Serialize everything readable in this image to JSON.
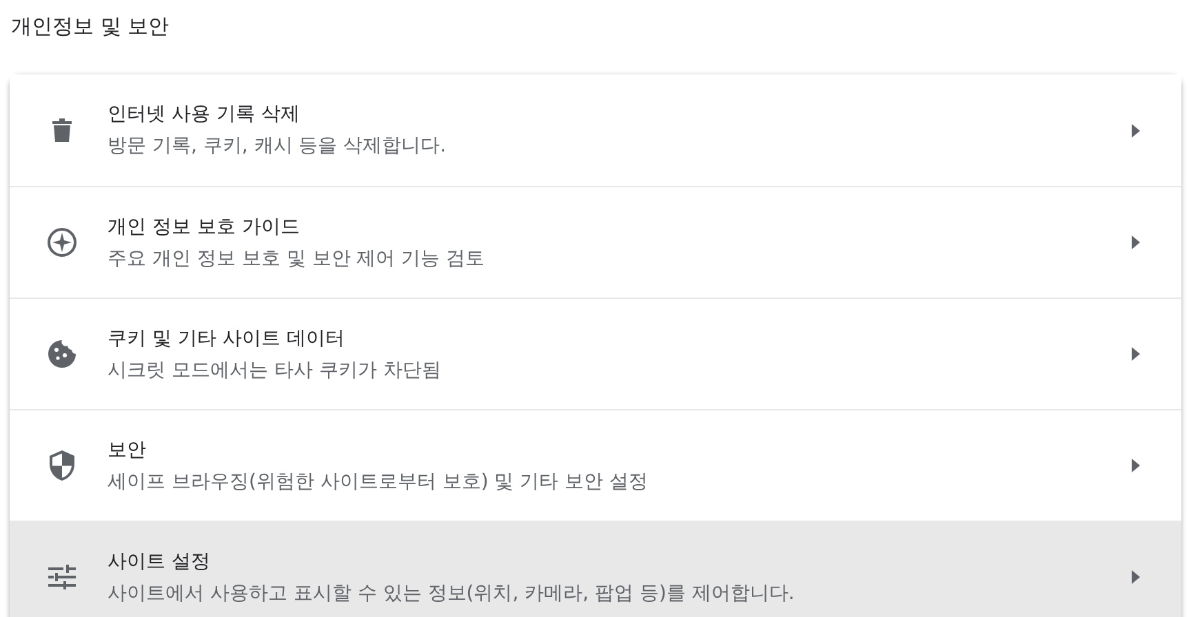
{
  "section_title": "개인정보 및 보안",
  "items": [
    {
      "kind": "delete",
      "title": "인터넷 사용 기록 삭제",
      "subtitle": "방문 기록, 쿠키, 캐시 등을 삭제합니다.",
      "highlighted": false
    },
    {
      "kind": "guide",
      "title": "개인 정보 보호 가이드",
      "subtitle": "주요 개인 정보 보호 및 보안 제어 기능 검토",
      "highlighted": false
    },
    {
      "kind": "cookies",
      "title": "쿠키 및 기타 사이트 데이터",
      "subtitle": "시크릿 모드에서는 타사 쿠키가 차단됨",
      "highlighted": false
    },
    {
      "kind": "security",
      "title": "보안",
      "subtitle": "세이프 브라우징(위험한 사이트로부터 보호) 및 기타 보안 설정",
      "highlighted": false
    },
    {
      "kind": "site-settings",
      "title": "사이트 설정",
      "subtitle": "사이트에서 사용하고 표시할 수 있는 정보(위치, 카메라, 팝업 등)를 제어합니다.",
      "highlighted": true
    }
  ]
}
